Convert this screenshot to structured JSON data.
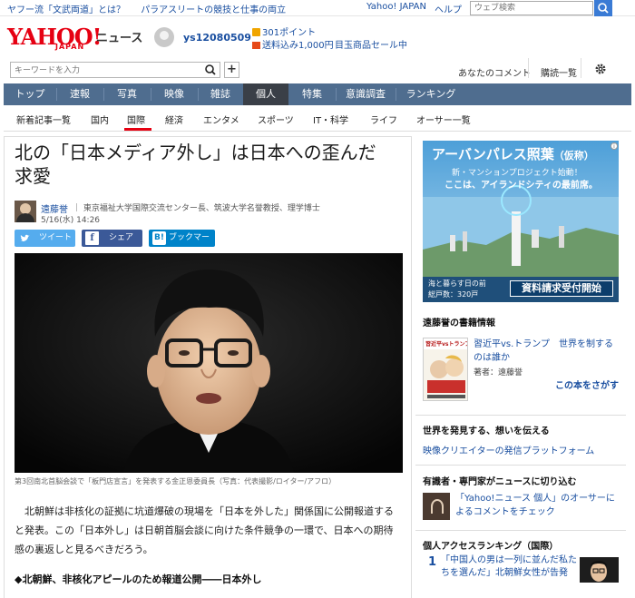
{
  "topbar": {
    "link1": "ヤフー流「文武両道」とは？",
    "link2": "パラアスリートの競技と仕事の両立",
    "yahoo_japan": "Yahoo! JAPAN",
    "help": "ヘルプ",
    "search_placeholder": "ウェブ検索"
  },
  "header": {
    "logo": "YAHOO!",
    "logo_sub": "JAPAN",
    "service": "ニュース",
    "username": "ys12080509",
    "points": "301ポイント",
    "shipping": "送料込み1,000円",
    "sale": "目玉商品セール中"
  },
  "searchrow": {
    "keyword_placeholder": "キーワードを入力",
    "plus": "+",
    "your_comments": "あなたのコメント",
    "subscriptions": "購読一覧"
  },
  "mainnav": {
    "items": [
      "トップ",
      "速報",
      "写真",
      "映像",
      "雑誌",
      "個人",
      "特集",
      "意識調査",
      "ランキング"
    ],
    "active": "個人"
  },
  "subnav": {
    "items": [
      "新着記事一覧",
      "国内",
      "国際",
      "経済",
      "エンタメ",
      "スポーツ",
      "IT・科学",
      "ライフ",
      "オーサー一覧"
    ],
    "active": "国際"
  },
  "article": {
    "title_line1": "北の「日本メディア外し」は日本への歪んだ",
    "title_line2": "求愛",
    "author_name": "遠藤誉",
    "author_title": "東京福祉大学国際交流センター長、筑波大学名誉教授、理学博士",
    "date": "5/16(水) 14:26",
    "share_tweet": "ツイート",
    "share_facebook": "シェア",
    "share_hatena": "ブックマーク",
    "caption": "第3回南北首脳会談で「板門店宣言」を発表する金正恩委員長（写真：代表撮影/ロイター/アフロ）",
    "body": "北朝鮮は非核化の証拠に坑道爆破の現場を「日本を外した」関係国に公開報道すると発表。この「日本外し」は日朝首脳会談に向けた条件競争の一環で、日本への期待感の裏返しと見るべきだろう。",
    "subhead": "◆北朝鮮、非核化アピールのため報道公開――日本外し"
  },
  "sidebar": {
    "ad": {
      "title": "アーバンパレス照葉",
      "title_sub": "（仮称）",
      "line1": "新・マンションプロジェクト始動！",
      "line2": "ここは、アイランドシティの最前席。",
      "price_label": "海と暮らす日の前",
      "price": "総戸数：320戸",
      "cta": "資料請求受付開始"
    },
    "books_title": "遠藤誉の書籍情報",
    "book_title": "習近平vs.トランプ　世界を制するのは誰か",
    "book_author": "著者：遠藤誉",
    "book_buy": "この本をさがす",
    "book_cover_title": "習近平vsトランプ",
    "sec2_title": "世界を発見する、想いを伝える",
    "sec2_link": "映像クリエイターの発信プラットフォーム",
    "sec3_title": "有識者・専門家がニュースに切り込む",
    "sec3_link": "「Yahoo!ニュース 個人」のオーサーによるコメントをチェック",
    "ranking_title": "個人アクセスランキング（国際）",
    "rank1_num": "1",
    "rank1_text": "「中国人の男は一列に並んだ私たちを選んだ」北朝鮮女性が告発"
  }
}
